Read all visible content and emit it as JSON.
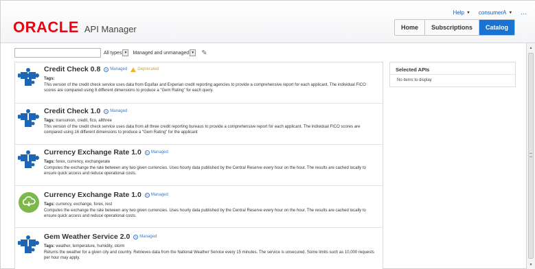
{
  "header": {
    "logo_text": "ORACLE",
    "product_name": "API Manager",
    "user_menu": {
      "help_label": "Help",
      "user_label": "consumerA",
      "more_label": "..."
    },
    "nav_tabs": [
      {
        "label": "Home",
        "active": false
      },
      {
        "label": "Subscriptions",
        "active": false
      },
      {
        "label": "Catalog",
        "active": true
      }
    ]
  },
  "filters": {
    "search": {
      "value": "",
      "placeholder": ""
    },
    "type_select": {
      "value": "All types"
    },
    "status_select": {
      "value": "Managed and unmanaged"
    }
  },
  "apis": [
    {
      "name": "Credit Check 0.8",
      "badge": "Managed",
      "deprecated_label": "Deprecated",
      "icon": "puzzle-icon",
      "tags_label": "Tags:",
      "tags": "",
      "description": "This version of the credit check service uses data from Equifax and Experian credit reporting agencies to provide a comprehensive report for each applicant. The individual FICO scores are compared using 8 different dimensions to produce a \"Gem Rating\" for each query."
    },
    {
      "name": "Credit Check 1.0",
      "badge": "Managed",
      "icon": "puzzle-icon",
      "tags_label": "Tags:",
      "tags": "transunion, credit, fico, allthree",
      "description": "This version of the credit check service uses data from all three credit reporting bureaus to provide a comprehensive report for each applicant. The individual FICO scores are compared using 16 different dimensions to produce a \"Gem Rating\" for the applicant"
    },
    {
      "name": "Currency Exchange Rate 1.0",
      "badge": "Managed",
      "icon": "puzzle-icon",
      "tags_label": "Tags:",
      "tags": "forex, currency, exchangerate",
      "description": "Computes the exchange the rate between any two given currencies. Uses hourly data published by the Central Reserve every hour on the hour. The results are cached locally to ensure quick access and reduce operational costs."
    },
    {
      "name": "Currency Exchange Rate 1.0",
      "badge": "Managed",
      "icon": "cloud-icon",
      "tags_label": "Tags:",
      "tags": "currency, exchange, forex, rest",
      "description": "Computes the exchange the rate between any two given currencies. Uses hourly data published by the Central Reserve every hour on the hour. The results are cached locally to ensure quick access and reduce operational costs."
    },
    {
      "name": "Gem Weather Service 2.0",
      "badge": "Managed",
      "icon": "puzzle-icon",
      "tags_label": "Tags:",
      "tags": "weather, temperature, humidity, storm",
      "description": "Returns the weather for a given city and country. Retrieves data from the National Weather Service every 15 minutes. The service is unsecured. Some limits such as 10,000 requests per hour may apply."
    }
  ],
  "selected_panel": {
    "title": "Selected APIs",
    "empty_text": "No items to display"
  },
  "colors": {
    "brand_red": "#e30613",
    "accent_blue": "#1873d3",
    "puzzle_blue": "#1d66b5",
    "cloud_green": "#7cb84a"
  }
}
